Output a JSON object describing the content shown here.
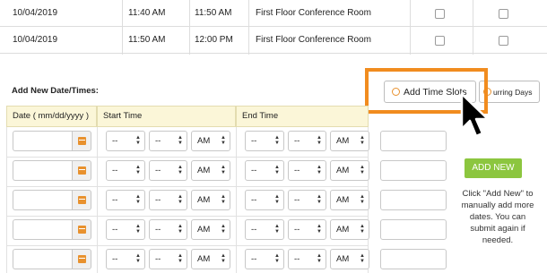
{
  "existing_rows": [
    {
      "date": "10/04/2019",
      "start": "11:40 AM",
      "end": "11:50 AM",
      "room": "First Floor Conference Room"
    },
    {
      "date": "10/04/2019",
      "start": "11:50 AM",
      "end": "12:00 PM",
      "room": "First Floor Conference Room"
    }
  ],
  "add_section": {
    "label": "Add New Date/Times:",
    "add_time_slots_label": "Add Time Slots",
    "recurring_days_label": "urring Days"
  },
  "grid": {
    "headers": {
      "date": "Date ( mm/dd/yyyy )",
      "start": "Start Time",
      "end": "End Time"
    },
    "hour_placeholder": "--",
    "minute_placeholder": "--",
    "ampm": "AM"
  },
  "add_new_label": "ADD NEW",
  "help_text": "Click \"Add New\" to manually add more dates. You can submit again if needed.",
  "colors": {
    "accent": "#f18c1f",
    "green": "#8cc63f",
    "header_bg": "#fbf6d8"
  }
}
